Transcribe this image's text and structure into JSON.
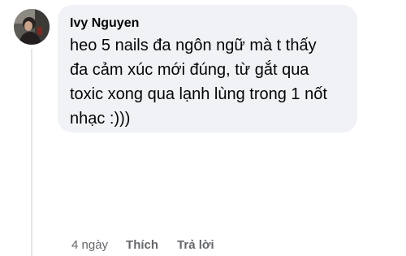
{
  "comment": {
    "author": "Ivy Nguyen",
    "text": "heo 5 nails đa ngôn ngữ mà t thấy đa cảm xúc mới đúng, từ gắt qua toxic xong qua lạnh lùng trong 1 nốt nhạc :)))",
    "timestamp": "4 ngày",
    "like_label": "Thích",
    "reply_label": "Trả lời"
  },
  "colors": {
    "bubble": "#f0f2f5",
    "text": "#050505",
    "secondary": "#65676b",
    "thread_line": "#e2e5e9"
  }
}
